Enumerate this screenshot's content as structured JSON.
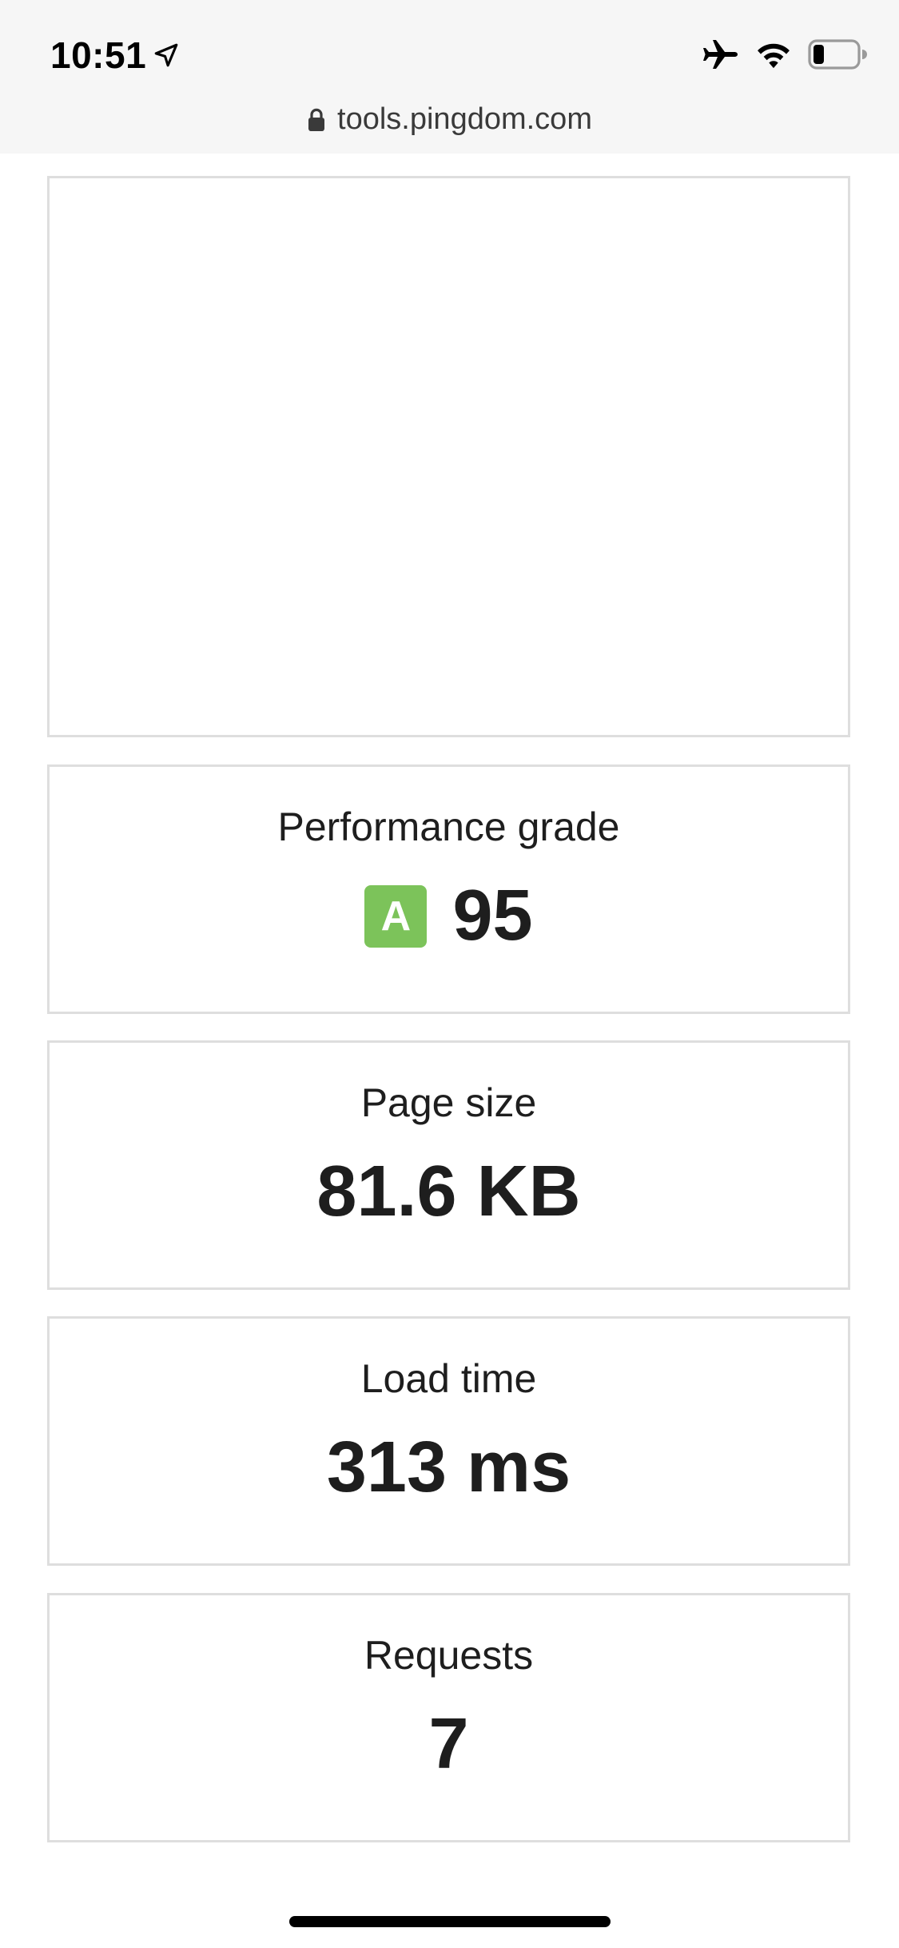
{
  "status_bar": {
    "time": "10:51",
    "icons": [
      "location-arrow-icon",
      "airplane-icon",
      "wifi-icon",
      "battery-icon"
    ],
    "battery_level": 0.25
  },
  "browser": {
    "url": "tools.pingdom.com",
    "lock_icon": "lock-icon"
  },
  "metrics": {
    "performance": {
      "label": "Performance grade",
      "grade": "A",
      "score": "95",
      "grade_color": "#7cc35a"
    },
    "page_size": {
      "label": "Page size",
      "value": "81.6 KB"
    },
    "load_time": {
      "label": "Load time",
      "value": "313 ms"
    },
    "requests": {
      "label": "Requests",
      "value": "7"
    }
  }
}
